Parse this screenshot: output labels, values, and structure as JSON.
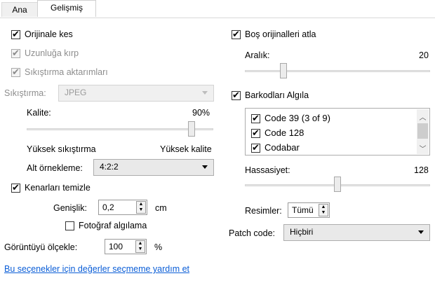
{
  "tabs": [
    {
      "label": "Ana"
    },
    {
      "label": "Gelişmiş"
    }
  ],
  "left": {
    "crop_to_original": {
      "label": "Orijinale kes",
      "checked": true
    },
    "crop_to_length": {
      "label": "Uzunluğa kırp",
      "checked": true
    },
    "compression_transfer": {
      "label": "Sıkıştırma aktarımları",
      "checked": true
    },
    "compression": {
      "label": "Sıkıştırma:",
      "value": "JPEG"
    },
    "quality": {
      "label": "Kalite:",
      "value": "90%",
      "level": 0.9
    },
    "quality_min": "Yüksek sıkıştırma",
    "quality_max": "Yüksek kalite",
    "subsampling": {
      "label": "Alt örnekleme:",
      "value": "4:2:2"
    },
    "clean_edges": {
      "label": "Kenarları temizle",
      "checked": true
    },
    "width": {
      "label": "Genişlik:",
      "value": "0,2",
      "unit": "cm"
    },
    "photo_detect": {
      "label": "Fotoğraf algılama",
      "checked": false
    },
    "scale": {
      "label": "Görüntüyü ölçekle:",
      "value": "100",
      "unit": "%"
    }
  },
  "right": {
    "skip_blank": {
      "label": "Boş orijinalleri atla",
      "checked": true
    },
    "interval": {
      "label": "Aralık:",
      "value": "20",
      "level": 0.2
    },
    "detect_barcodes": {
      "label": "Barkodları Algıla",
      "checked": true
    },
    "barcode_list": [
      {
        "label": "Code 39 (3 of 9)",
        "checked": true
      },
      {
        "label": "Code 128",
        "checked": true
      },
      {
        "label": "Codabar",
        "checked": true
      }
    ],
    "sensitivity": {
      "label": "Hassasiyet:",
      "value": "128",
      "level": 0.5
    },
    "images": {
      "label": "Resimler:",
      "value": "Tümü"
    },
    "patch_code": {
      "label": "Patch code:",
      "value": "Hiçbiri"
    }
  },
  "help_link": "Bu seçenekler için değerler seçmeme yardım et",
  "colors": {
    "link": "#0b5ed7",
    "disabled_text": "#8d8d8d"
  },
  "icons": [
    "checkmark-icon",
    "chevron-down-icon",
    "spin-updown-icon",
    "scroll-up-icon",
    "scroll-down-icon"
  ]
}
